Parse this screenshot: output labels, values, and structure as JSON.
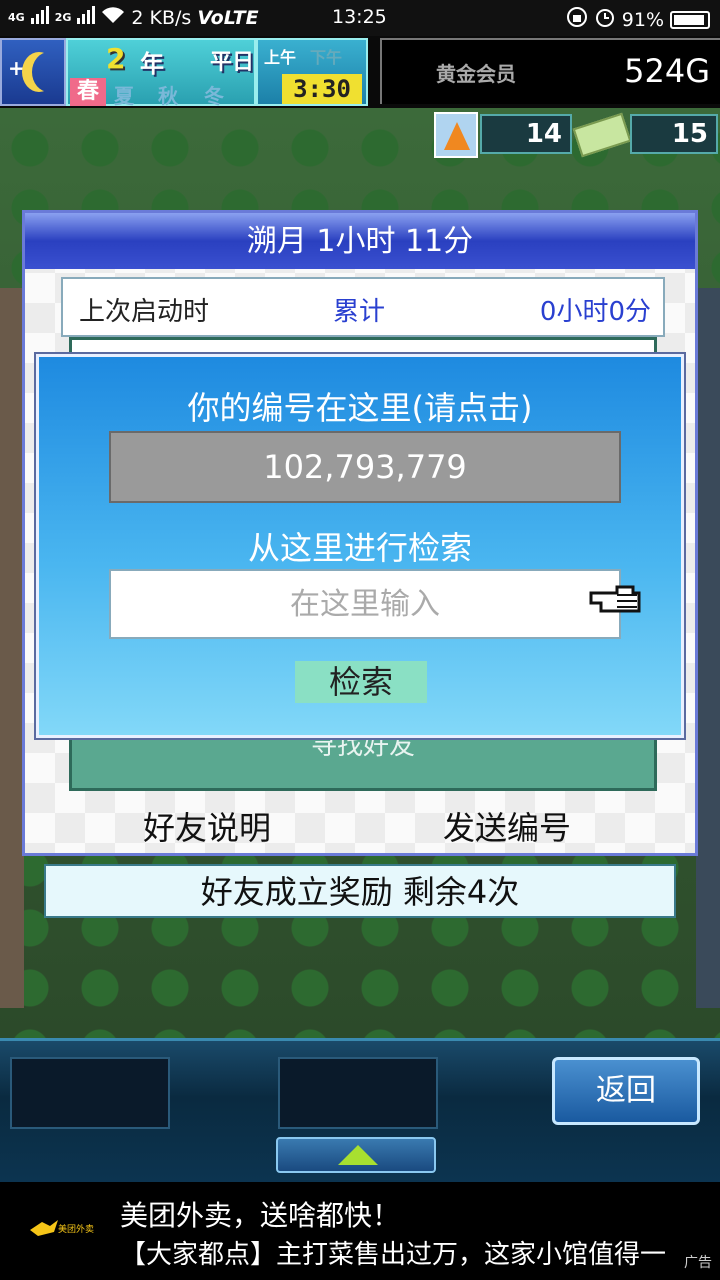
{
  "status_bar": {
    "signal_1": "4G",
    "signal_2": "2G",
    "speed": "2 KB/s",
    "volte": "VoLTE",
    "time": "13:25",
    "battery": "91%"
  },
  "hud": {
    "year_num": "2",
    "year_label": "年",
    "weekday": "平日",
    "seasons": [
      "春",
      "夏",
      "秋",
      "冬"
    ],
    "active_season": "春",
    "am": "上午",
    "pm": "下午",
    "clock": "3:30",
    "membership": "黄金会员",
    "gold": "524G",
    "potion_count": "14",
    "ticket_count": "15"
  },
  "friend_panel": {
    "header": "溯月  1小时 11分",
    "last_launch_label": "上次启动时",
    "total_label": "累计",
    "total_value": "0小时0分",
    "find_friend": "寻找好友",
    "help_link": "好友说明",
    "send_id_link": "发送编号"
  },
  "bonus_bar": {
    "text": "好友成立奖励  剩余4次"
  },
  "search_dialog": {
    "title": "你的编号在这里(请点击)",
    "id_value": "102,793,779",
    "search_hint": "从这里进行检索",
    "input_placeholder": "在这里输入",
    "search_button": "检索"
  },
  "bottom_nav": {
    "back_button": "返回"
  },
  "ad": {
    "logo_text": "美团外卖",
    "line1": "美团外卖，送啥都快！",
    "line2": "【大家都点】主打菜售出过万，这家小馆值得一",
    "tag": "广告"
  },
  "colors": {
    "dialog_top": "#1e8ae0",
    "dialog_bottom": "#82d8f8",
    "panel_header": "#2a40c0",
    "accent_text": "#2a40d0",
    "search_button": "#8ae0c4"
  }
}
